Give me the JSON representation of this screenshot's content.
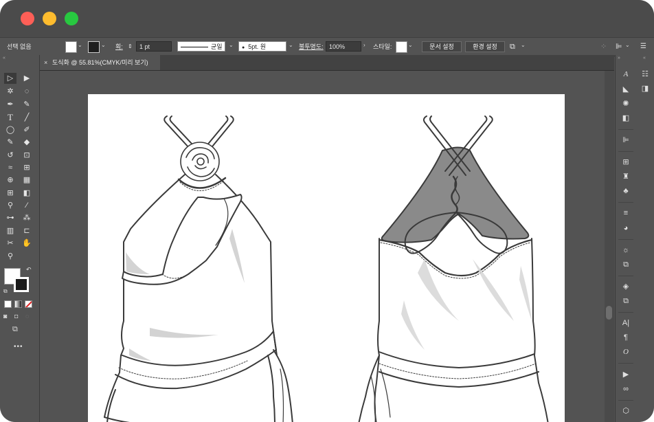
{
  "colors": {
    "chrome": "#535353",
    "titlebar": "#4b4b4b",
    "red": "#fe5f57",
    "yellow": "#febc2e",
    "green": "#28c840",
    "dress_fill": "#ffffff",
    "lining": "#8a8a8a",
    "stroke": "#3a3a3a"
  },
  "control_bar": {
    "selection_label": "선택 없음",
    "stroke_label": "획:",
    "stroke_weight": "1 pt",
    "profile_label": "균일",
    "brush_label": "5pt. 원",
    "opacity_label": "불투명도:",
    "opacity_value": "100%",
    "style_label": "스타일:",
    "doc_setup_button": "문서 설정",
    "preferences_button": "환경 설정"
  },
  "document_tab": {
    "close": "×",
    "title": "도식화 @ 55.81%(CMYK/미리 보기)"
  },
  "tools": [
    {
      "name": "selection-tool",
      "glyph": "▷"
    },
    {
      "name": "direct-selection-tool",
      "glyph": "▶"
    },
    {
      "name": "magic-wand-tool",
      "glyph": "✲"
    },
    {
      "name": "lasso-tool",
      "glyph": "◌"
    },
    {
      "name": "pen-tool",
      "glyph": "✒"
    },
    {
      "name": "curvature-tool",
      "glyph": "✎"
    },
    {
      "name": "type-tool",
      "glyph": "T"
    },
    {
      "name": "line-tool",
      "glyph": "╱"
    },
    {
      "name": "ellipse-tool",
      "glyph": "◯"
    },
    {
      "name": "paintbrush-tool",
      "glyph": "✐"
    },
    {
      "name": "shaper-tool",
      "glyph": "✎"
    },
    {
      "name": "eraser-tool",
      "glyph": "◆"
    },
    {
      "name": "rotate-tool",
      "glyph": "↺"
    },
    {
      "name": "scale-tool",
      "glyph": "⊡"
    },
    {
      "name": "warp-tool",
      "glyph": "≈"
    },
    {
      "name": "free-transform-tool",
      "glyph": "⊞"
    },
    {
      "name": "shape-builder-tool",
      "glyph": "⊕"
    },
    {
      "name": "perspective-grid-tool",
      "glyph": "▦"
    },
    {
      "name": "mesh-tool",
      "glyph": "⊞"
    },
    {
      "name": "gradient-tool",
      "glyph": "◧"
    },
    {
      "name": "eyedropper-tool",
      "glyph": "⚲"
    },
    {
      "name": "measure-tool",
      "glyph": "⁄"
    },
    {
      "name": "blend-tool",
      "glyph": "⊶"
    },
    {
      "name": "symbol-sprayer-tool",
      "glyph": "⁂"
    },
    {
      "name": "column-graph-tool",
      "glyph": "▥"
    },
    {
      "name": "artboard-tool",
      "glyph": "⊏"
    },
    {
      "name": "slice-tool",
      "glyph": "✂"
    },
    {
      "name": "hand-tool",
      "glyph": "✋"
    },
    {
      "name": "zoom-tool",
      "glyph": "⚲"
    }
  ],
  "more_tools": "•••",
  "panel_icons": [
    "character-styles",
    "shape-builder",
    "color-guide",
    "gradient",
    "align",
    "transform",
    "symbols",
    "club-symbols",
    "stroke",
    "transparency",
    "appearance",
    "graphic-styles",
    "layers",
    "artboards",
    "character",
    "paragraph",
    "opentype",
    "actions",
    "links",
    "libraries"
  ]
}
